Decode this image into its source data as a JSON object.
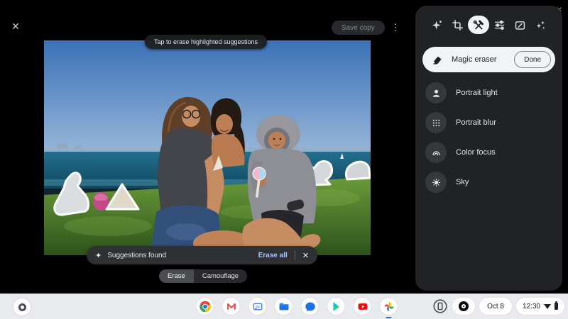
{
  "editor": {
    "close_glyph": "✕",
    "more_glyph": "⋮",
    "save_copy_label": "Save copy",
    "tooltip": "Tap to erase highlighted suggestions",
    "toast": {
      "sparkle_glyph": "✦",
      "text": "Suggestions found",
      "action_label": "Erase all",
      "close_glyph": "✕"
    },
    "modes": [
      {
        "label": "Erase",
        "selected": true
      },
      {
        "label": "Camouflage",
        "selected": false
      }
    ]
  },
  "window_controls": {
    "close_glyph": "✕"
  },
  "panel": {
    "tabs": [
      {
        "icon": "suggestions-icon",
        "selected": false
      },
      {
        "icon": "crop-rotate-icon",
        "selected": false
      },
      {
        "icon": "tools-icon",
        "selected": true
      },
      {
        "icon": "adjust-icon",
        "selected": false
      },
      {
        "icon": "markup-icon",
        "selected": false
      },
      {
        "icon": "filters-icon",
        "selected": false
      }
    ],
    "active_tool": {
      "label": "Magic eraser",
      "action_label": "Done",
      "icon": "eraser-icon"
    },
    "tools": [
      {
        "label": "Portrait light",
        "icon": "portrait-light-icon"
      },
      {
        "label": "Portrait blur",
        "icon": "portrait-blur-icon"
      },
      {
        "label": "Color focus",
        "icon": "color-focus-icon"
      },
      {
        "label": "Sky",
        "icon": "sky-icon"
      }
    ]
  },
  "shelf": {
    "apps": [
      "chrome",
      "gmail",
      "screencast",
      "files",
      "messages",
      "play-store",
      "youtube",
      "google-photos"
    ],
    "active_app": "google-photos",
    "status": {
      "date": "Oct 8",
      "time": "12:30"
    }
  },
  "colors": {
    "accent_blue": "#a8c7fa",
    "panel_bg": "#212225",
    "selected_pill": "#f1f3f4",
    "shelf_bg": "#e9eaed"
  }
}
